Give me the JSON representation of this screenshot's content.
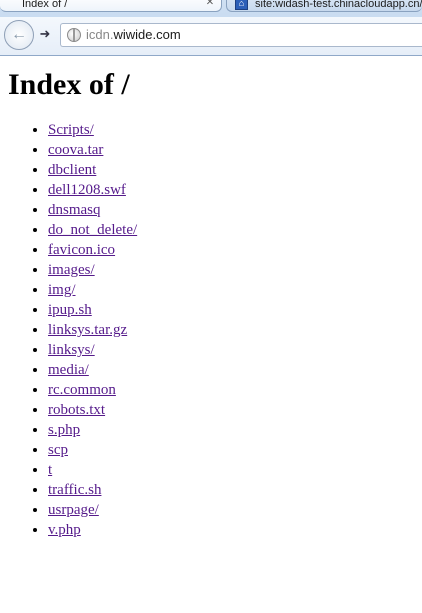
{
  "browser": {
    "tabs": [
      {
        "title": "Index of /",
        "active": true
      },
      {
        "title": "site:widash-test.chinacloudapp.cn/portal - 百度搜索",
        "active": false
      }
    ],
    "address_bar": {
      "prefix": "icdn.",
      "host": "wiwide.com"
    }
  },
  "page": {
    "title": "Index of /",
    "entries": [
      "Scripts/",
      "coova.tar",
      "dbclient",
      "dell1208.swf",
      "dnsmasq",
      "do_not_delete/",
      "favicon.ico",
      "images/",
      "img/",
      "ipup.sh",
      "linksys.tar.gz",
      "linksys/",
      "media/",
      "rc.common",
      "robots.txt",
      "s.php",
      "scp",
      "t",
      "traffic.sh",
      "usrpage/",
      "v.php"
    ]
  },
  "colors": {
    "visited_link": "#551a8b",
    "chrome_bg": "#cfe0f3"
  }
}
